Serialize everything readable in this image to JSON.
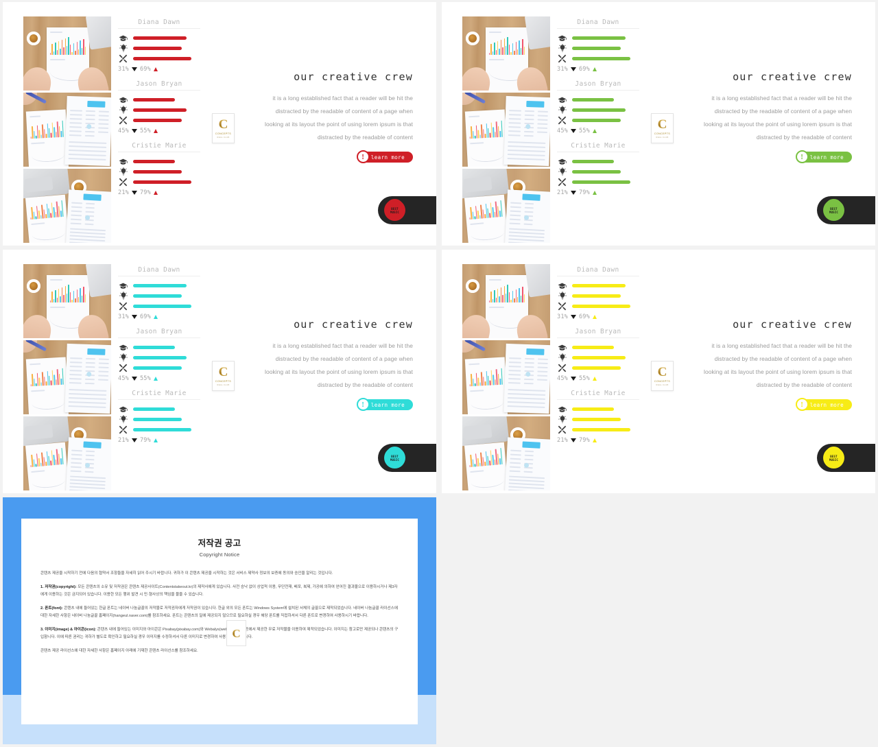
{
  "deck": {
    "slides": [
      {
        "id": "slide-red",
        "accent": "#cf1f27",
        "accent_soft": "#cf1f27",
        "badge_text_color": "#1b1b1b"
      },
      {
        "id": "slide-green",
        "accent": "#7ac143",
        "accent_soft": "#7ac143",
        "badge_text_color": "#1b1b1b"
      },
      {
        "id": "slide-cyan",
        "accent": "#2fdcd8",
        "accent_soft": "#2fdcd8",
        "badge_text_color": "#1b1b1b"
      },
      {
        "id": "slide-yellow",
        "accent": "#f7ec16",
        "accent_soft": "#f7ec16",
        "badge_text_color": "#1b1b1b"
      }
    ]
  },
  "team": {
    "members": [
      {
        "name": "Diana Dawn",
        "skills": [
          {
            "icon": "graduation-cap-icon",
            "value": 80
          },
          {
            "icon": "lightbulb-icon",
            "value": 72
          },
          {
            "icon": "tools-icon",
            "value": 87
          }
        ],
        "pct_down": "31%",
        "pct_up": "69%"
      },
      {
        "name": "Jason Bryan",
        "skills": [
          {
            "icon": "graduation-cap-icon",
            "value": 62
          },
          {
            "icon": "lightbulb-icon",
            "value": 80
          },
          {
            "icon": "tools-icon",
            "value": 72
          }
        ],
        "pct_down": "45%",
        "pct_up": "55%"
      },
      {
        "name": "Cristie Marie",
        "skills": [
          {
            "icon": "graduation-cap-icon",
            "value": 62
          },
          {
            "icon": "lightbulb-icon",
            "value": 72
          },
          {
            "icon": "tools-icon",
            "value": 87
          }
        ],
        "pct_down": "21%",
        "pct_up": "79%"
      }
    ]
  },
  "copy": {
    "title": "our creative crew",
    "body_lines": [
      "it is a long established fact that a reader  will be hit the",
      "distracted by the readable of  content of a page when",
      "looking at its layout the point of using lorem ipsum is that",
      "distracted by the readable of  content"
    ],
    "button_label": "learn more",
    "button_mark": "!"
  },
  "logo": {
    "letter": "C",
    "sub1": "CONCEPTS",
    "sub2": "REAL  CLUB"
  },
  "badge": {
    "line1": "BEST",
    "line2": "MUSIC"
  },
  "copyright": {
    "title": "저작권 공고",
    "subtitle": "Copyright Notice",
    "intro": "콘텐츠 제공을 시작하기 전에 다음의 협약서 조항들을 자세히 읽어 주시기 바랍니다. 귀하가 이 콘텐츠 제공을 시작하는 것은 서비스 제약사 정보의 보증에 동의와 승인을 알리는 것입니다.",
    "sections": [
      {
        "heading": "1. 저작권(copyright):",
        "text": " 모든 콘텐츠의 소유 및 저작권은 콘텐츠 제공사이트(Contentstakeout.kr)의 제작사에게 있습니다. 사전 승낙 없이 상업적 이용, 무단전재, 배포, 복제, 가공에 의하여 얻어진 결과물으로 이용하시거나 제3자에게 이용하는 것은 금지되어 있습니다. 이용한 모든 행위 발견 시 민·형사상의 책임을 물을 수 있습니다."
      },
      {
        "heading": "2. 폰트(font):",
        "text": " 콘텐츠 내에 들어있는 한글 폰트는 네이버 나눔글꼴의 저작물로 저작권자에게 저작권이 있습니다. 한글 외의 모든 폰트는 Windows System에 설치된 서체의 글꼴으로 제작되었습니다. 네이버 나눔글꼴 라이선스에 대한 자세한 사항은 네이버 나눔글꼴 홈페이지(hangeul.naver.com)를 참조하세요. 폰트는 콘텐츠의 일에 제공되지 않으므로 필요하실 경우 해당 폰트를 직접하셔서 다른 폰트로 변경하여 사용하시기 바랍니다."
      },
      {
        "heading": "3. 이미지(image) & 아이콘(icon):",
        "text": " 콘텐츠 내에 들어있는 이미지와 아이콘은 Pixabay(pixabay.com)와 Webalys(webalys.com) 등에서 제공한 무료 저작물을 이용하여 제작되었습니다. 이미지는 참고로만 제공되나 콘텐츠의 구입함니다. 이에 따른 권리는 귀하가 별도로 확인하고 필요하실 경우 이미지를 수정하셔서 다른 이미지로 변경하여 사용하시기 바랍니다."
      }
    ],
    "footer": "콘텐츠 제공 라이선스에 대한 자세한 사항은 홈페이지 아래에 기재한 콘텐츠 라이선스를 참조하세요."
  }
}
